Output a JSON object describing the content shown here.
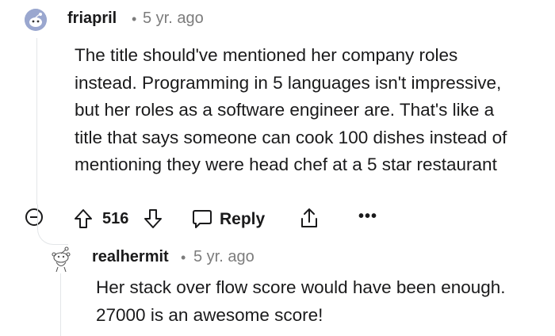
{
  "comment": {
    "author": "friapril",
    "separator": "•",
    "age": "5 yr. ago",
    "body": "The title should've mentioned her company roles instead. Programming in 5 languages isn't impressive, but her roles as a software engineer are. That's like a title that says someone can cook 100 dishes instead of mentioning they were head chef at a 5 star restaurant",
    "score": "516",
    "reply_label": "Reply",
    "more_label": "•••",
    "icons": {
      "collapse": "collapse-minus-icon",
      "upvote": "upvote-arrow-icon",
      "downvote": "downvote-arrow-icon",
      "reply": "speech-bubble-icon",
      "share": "share-icon"
    }
  },
  "reply": {
    "author": "realhermit",
    "separator": "•",
    "age": "5 yr. ago",
    "body": "Her stack over flow score would have been enough. 27000 is an awesome score!"
  },
  "colors": {
    "text": "#1a1a1b",
    "meta": "#7c7c7c",
    "avatar_bg": "#9aa7cf",
    "thread_line": "#e3e6e8"
  }
}
